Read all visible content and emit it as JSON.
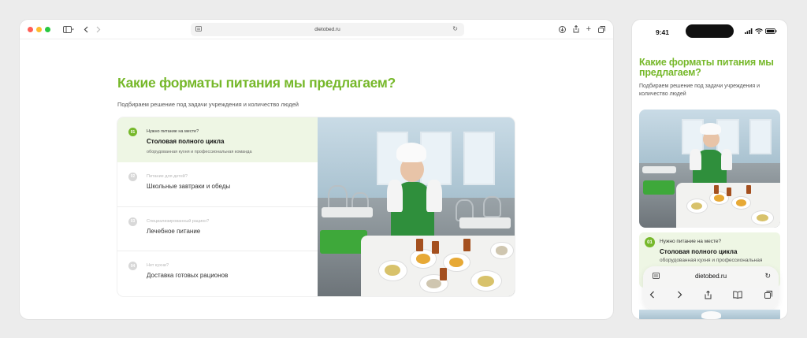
{
  "browser": {
    "url": "dietobed.ru",
    "traffic_lights": [
      "#ff5f57",
      "#febc2e",
      "#28c840"
    ]
  },
  "section": {
    "title": "Какие форматы питания мы предлагаем?",
    "subtitle": "Подбираем решение под задачи учреждения и количество людей",
    "items": [
      {
        "num": "01",
        "question": "Нужно питание на месте?",
        "title": "Столовая полного цикла",
        "desc": "оборудованная кухня и профессиональная команда"
      },
      {
        "num": "02",
        "question": "Питание для детей?",
        "title": "Школьные завтраки и обеды",
        "desc": ""
      },
      {
        "num": "03",
        "question": "Специализированный рацион?",
        "title": "Лечебное питание",
        "desc": ""
      },
      {
        "num": "04",
        "question": "Нет кухни?",
        "title": "Доставка готовых рационов",
        "desc": ""
      }
    ]
  },
  "phone": {
    "time": "9:41",
    "title": "Какие форматы питания мы предлагаем?",
    "subtitle": "Подбираем решение под задачи учреждения и количество людей",
    "active_item": {
      "num": "01",
      "question": "Нужно питание на месте?",
      "title": "Столовая полного цикла",
      "desc": "оборудованная кухня и профессиональная"
    },
    "url": "dietobed.ru"
  },
  "colors": {
    "accent": "#76b82a",
    "active_bg": "#eef6e4"
  }
}
